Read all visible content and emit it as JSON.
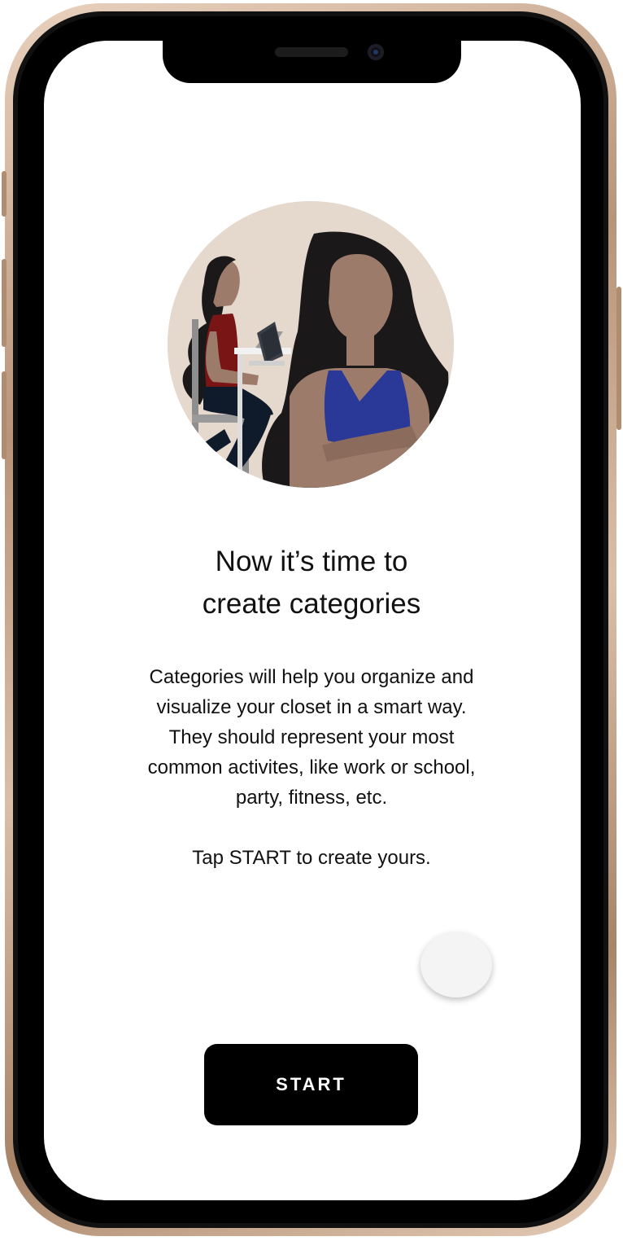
{
  "onboarding": {
    "heading": "Now it’s time to\ncreate categories",
    "body": "Categories will help you organize and\nvisualize your closet in a smart way.\nThey should represent your most\ncommon activites, like work or school,\nparty, fitness, etc.",
    "tap_hint": "Tap START to create yours.",
    "start_label": "START"
  },
  "colors": {
    "button_bg": "#000000",
    "illustration_bg": "#e5d8cd",
    "skin": "#9c7b6b",
    "hair": "#1b1819",
    "top_blue": "#2a3898",
    "top_red": "#7a1515"
  }
}
